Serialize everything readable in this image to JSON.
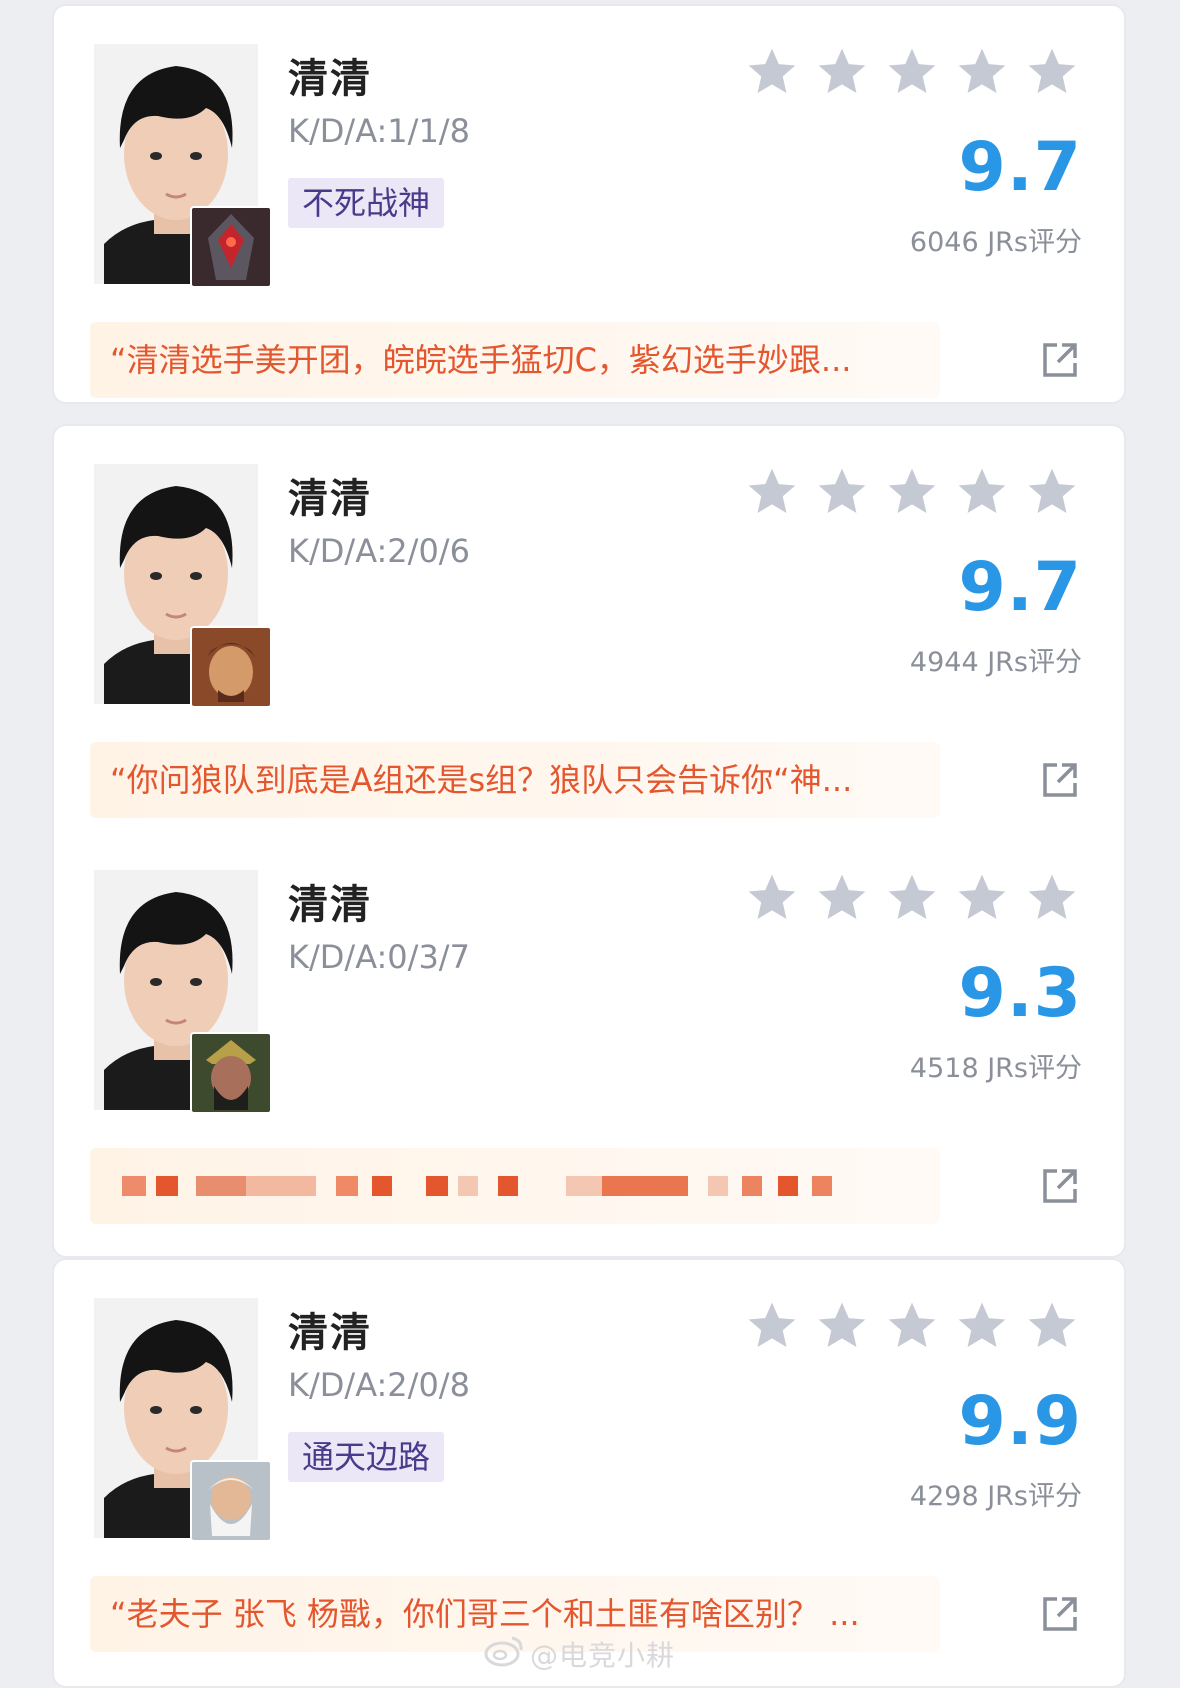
{
  "entries": [
    {
      "name": "清清",
      "kda": "K/D/A:1/1/8",
      "tag": "不死战神",
      "score": "9.7",
      "count": "6046 JRs评分",
      "quote": "“清清选手美开团，皖皖选手猛切C，紫幻选手妙跟...",
      "hero_icon": "dark-armored-hero-icon",
      "star_color": "#c5c9d3"
    },
    {
      "name": "清清",
      "kda": "K/D/A:2/0/6",
      "tag": "",
      "score": "9.7",
      "count": "4944 JRs评分",
      "quote": "“你问狼队到底是A组还是s组？狼队只会告诉你“神...",
      "hero_icon": "warrior-hero-icon",
      "star_color": "#c5c9d3"
    },
    {
      "name": "清清",
      "kda": "K/D/A:0/3/7",
      "tag": "",
      "score": "9.3",
      "count": "4518 JRs评分",
      "quote": "",
      "hero_icon": "general-hero-icon",
      "star_color": "#c5c9d3"
    },
    {
      "name": "清清",
      "kda": "K/D/A:2/0/8",
      "tag": "通天边路",
      "score": "9.9",
      "count": "4298 JRs评分",
      "quote": "“老夫子 张飞 杨戬，你们哥三个和土匪有啥区别？ ...",
      "hero_icon": "old-master-hero-icon",
      "star_color": "#c5c9d3"
    }
  ],
  "watermark": "@电竞小耕",
  "colors": {
    "score": "#2a97e6",
    "quote": "#e4572e",
    "tag_bg": "#ebe7f7",
    "tag_text": "#4a3a8a"
  }
}
